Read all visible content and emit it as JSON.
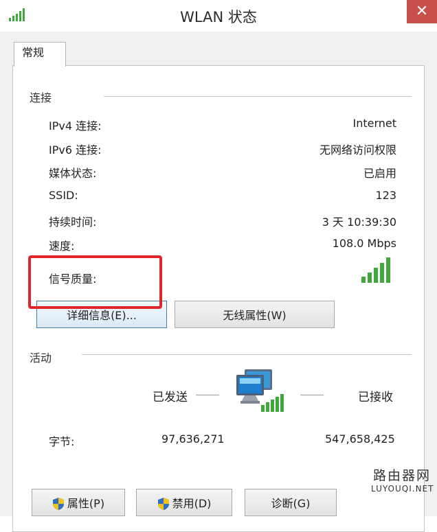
{
  "window": {
    "title": "WLAN 状态",
    "close_glyph": "✕"
  },
  "tab": {
    "label": "常规"
  },
  "connection": {
    "label": "连接",
    "rows": [
      {
        "label": "IPv4 连接:",
        "value": "Internet"
      },
      {
        "label": "IPv6 连接:",
        "value": "无网络访问权限"
      },
      {
        "label": "媒体状态:",
        "value": "已启用"
      },
      {
        "label": "SSID:",
        "value": "123"
      },
      {
        "label": "持续时间:",
        "value": "3 天 10:39:30"
      },
      {
        "label": "速度:",
        "value": "108.0 Mbps"
      }
    ],
    "signal_label": "信号质量:",
    "signal_bars": 5,
    "buttons": {
      "details": "详细信息(E)...",
      "wireless": "无线属性(W)"
    }
  },
  "activity": {
    "label": "活动",
    "sent": "已发送",
    "received": "已接收",
    "bytes_label": "字节:",
    "bytes_sent": "97,636,271",
    "bytes_received": "547,658,425"
  },
  "bottom_buttons": {
    "properties": "属性(P)",
    "disable": "禁用(D)",
    "diagnose": "诊断(G)"
  },
  "watermark": {
    "cn": "路由器网",
    "en": "LUYOUQI.NET"
  },
  "colors": {
    "accent_red": "#e0262b",
    "signal_green": "#3ea83a",
    "close_red": "#c7504a"
  },
  "icons": [
    "signal-strength-icon",
    "network-computers-icon",
    "uac-shield-icon"
  ]
}
